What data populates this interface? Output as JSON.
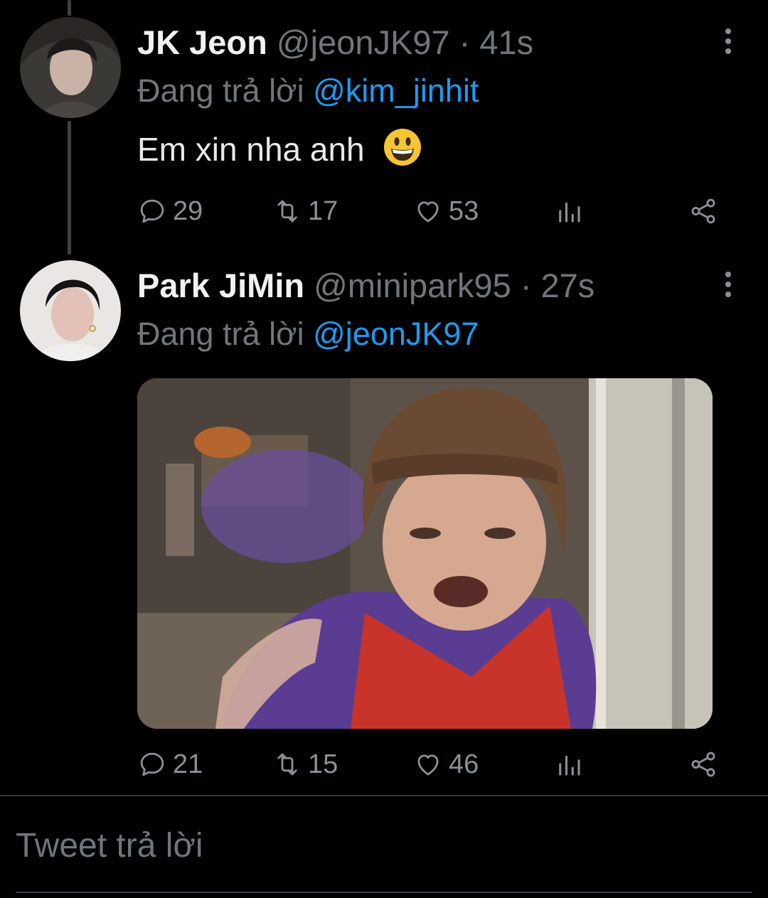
{
  "tweets": [
    {
      "name": "JK Jeon",
      "handle": "@jeonJK97",
      "separator": "·",
      "time": "41s",
      "replying_label": "Đang trả lời",
      "replying_to": "@kim_jinhit",
      "text": "Em xin nha anh",
      "emoji": "grinning-face",
      "actions": {
        "replies": "29",
        "retweets": "17",
        "likes": "53"
      }
    },
    {
      "name": "Park JiMin",
      "handle": "@minipark95",
      "separator": "·",
      "time": "27s",
      "replying_label": "Đang trả lời",
      "replying_to": "@jeonJK97",
      "media": "gif-angry-girl",
      "actions": {
        "replies": "21",
        "retweets": "15",
        "likes": "46"
      }
    }
  ],
  "compose": {
    "placeholder": "Tweet trả lời"
  },
  "colors": {
    "accent": "#1d9bf0",
    "muted": "#71767b",
    "background": "#000000"
  },
  "icons": [
    "reply-icon",
    "retweet-icon",
    "like-icon",
    "views-icon",
    "share-icon",
    "more-icon"
  ]
}
